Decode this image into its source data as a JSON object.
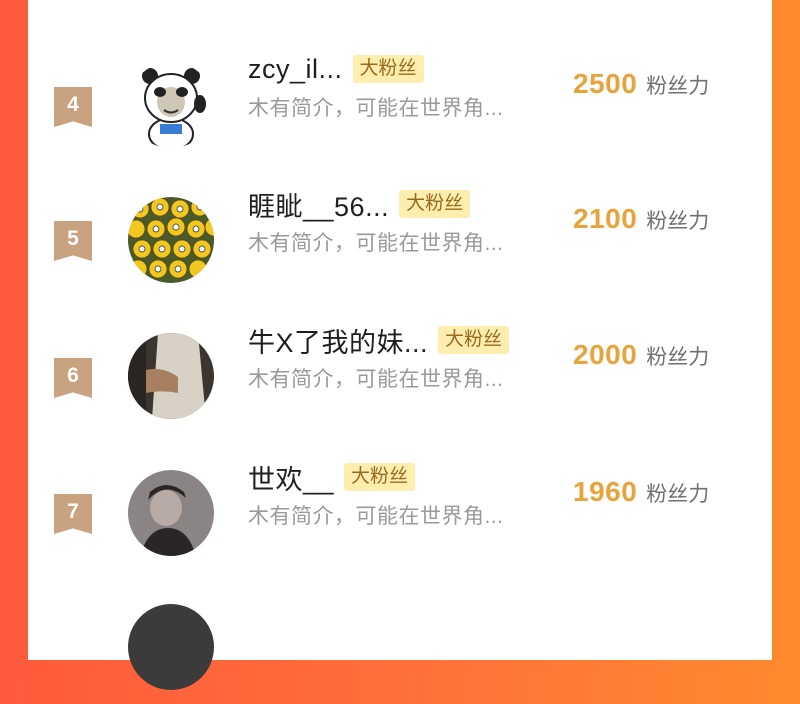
{
  "leaderboard": {
    "badge_label": "大粉丝",
    "unit_label": "粉丝力",
    "rows": [
      {
        "rank": "4",
        "name": "zcy_il...",
        "bio": "木有简介，可能在世界角...",
        "score": "2500",
        "avatar_icon": "panda-meme-avatar"
      },
      {
        "rank": "5",
        "name": "睚眦__56...",
        "bio": "木有简介，可能在世界角...",
        "score": "2100",
        "avatar_icon": "minions-avatar"
      },
      {
        "rank": "6",
        "name": "牛X了我的妹...",
        "bio": "木有简介，可能在世界角...",
        "score": "2000",
        "avatar_icon": "photo-avatar"
      },
      {
        "rank": "7",
        "name": "世欢__",
        "bio": "木有简介，可能在世界角...",
        "score": "1960",
        "avatar_icon": "portrait-avatar"
      }
    ]
  },
  "colors": {
    "rank_bg": "#c9a27f",
    "score": "#e8a33d",
    "badge_bg": "#fdeeb0",
    "badge_text": "#9a6a1c"
  }
}
